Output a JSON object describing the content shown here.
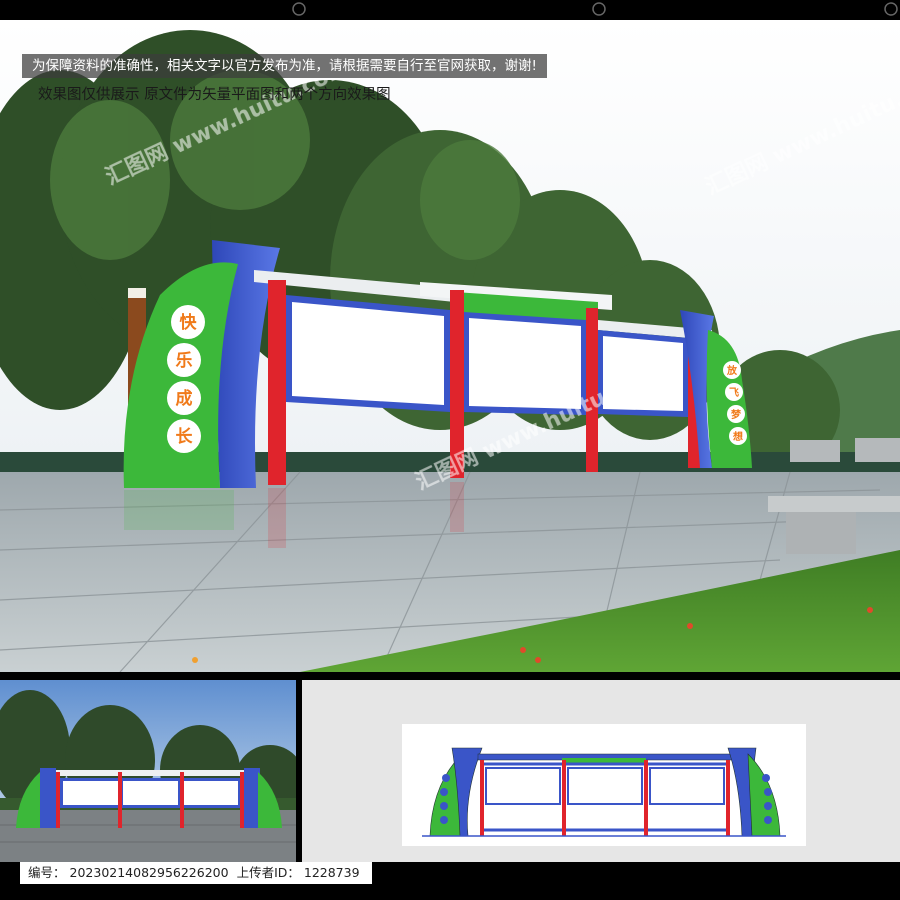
{
  "notice": "为保障资料的准确性，相关文字以官方发布为准，请根据需要自行至官网获取，谢谢!",
  "subnotice": "效果图仅供展示  原文件为矢量平面图和两个方向效果图",
  "sign": {
    "left_chars": [
      "快",
      "乐",
      "成",
      "长"
    ],
    "right_chars": [
      "放",
      "飞",
      "梦",
      "想"
    ]
  },
  "watermark": "汇图网 www.huitu.com",
  "footer": {
    "id_label": "编号：",
    "id_value": "20230214082956226200",
    "uploader_label": "上传者ID：",
    "uploader_value": "1228739"
  },
  "colors": {
    "green": "#3cb83a",
    "blue": "#3a55c8",
    "red": "#e0242c",
    "orange": "#f07a1a"
  }
}
